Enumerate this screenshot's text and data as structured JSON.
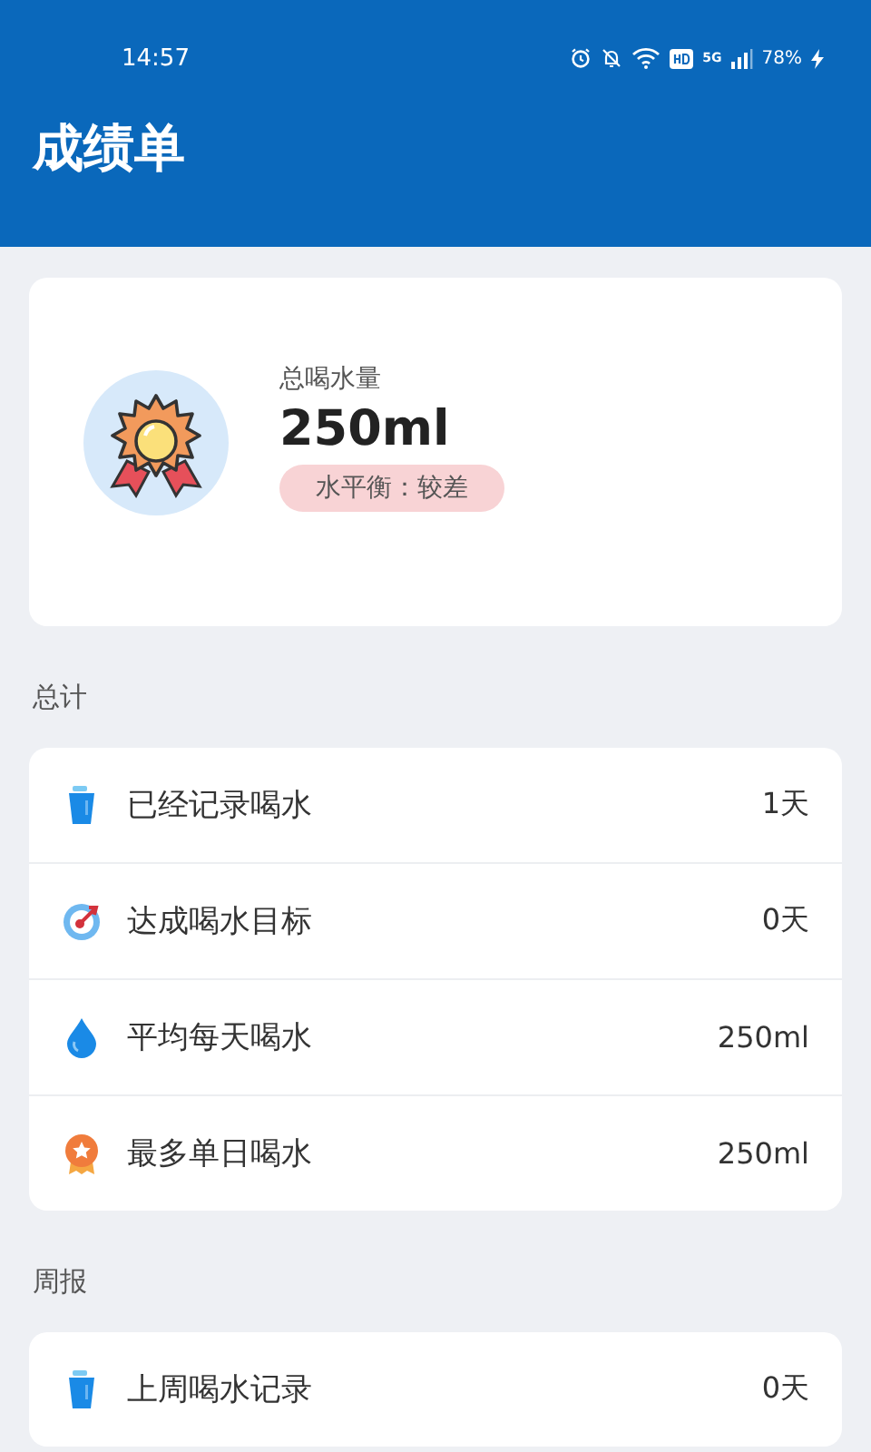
{
  "status_bar": {
    "time": "14:57",
    "network": "5G",
    "battery": "78%"
  },
  "header": {
    "title": "成绩单"
  },
  "summary": {
    "label": "总喝水量",
    "value": "250ml",
    "badge": "水平衡：较差"
  },
  "sections": [
    {
      "title": "总计",
      "rows": [
        {
          "kind": "cup",
          "label": "已经记录喝水",
          "value": "1天"
        },
        {
          "kind": "target",
          "label": "达成喝水目标",
          "value": "0天"
        },
        {
          "kind": "drop",
          "label": "平均每天喝水",
          "value": "250ml"
        },
        {
          "kind": "medal",
          "label": "最多单日喝水",
          "value": "250ml"
        }
      ]
    },
    {
      "title": "周报",
      "rows": [
        {
          "kind": "cup",
          "label": "上周喝水记录",
          "value": "0天"
        }
      ]
    }
  ]
}
